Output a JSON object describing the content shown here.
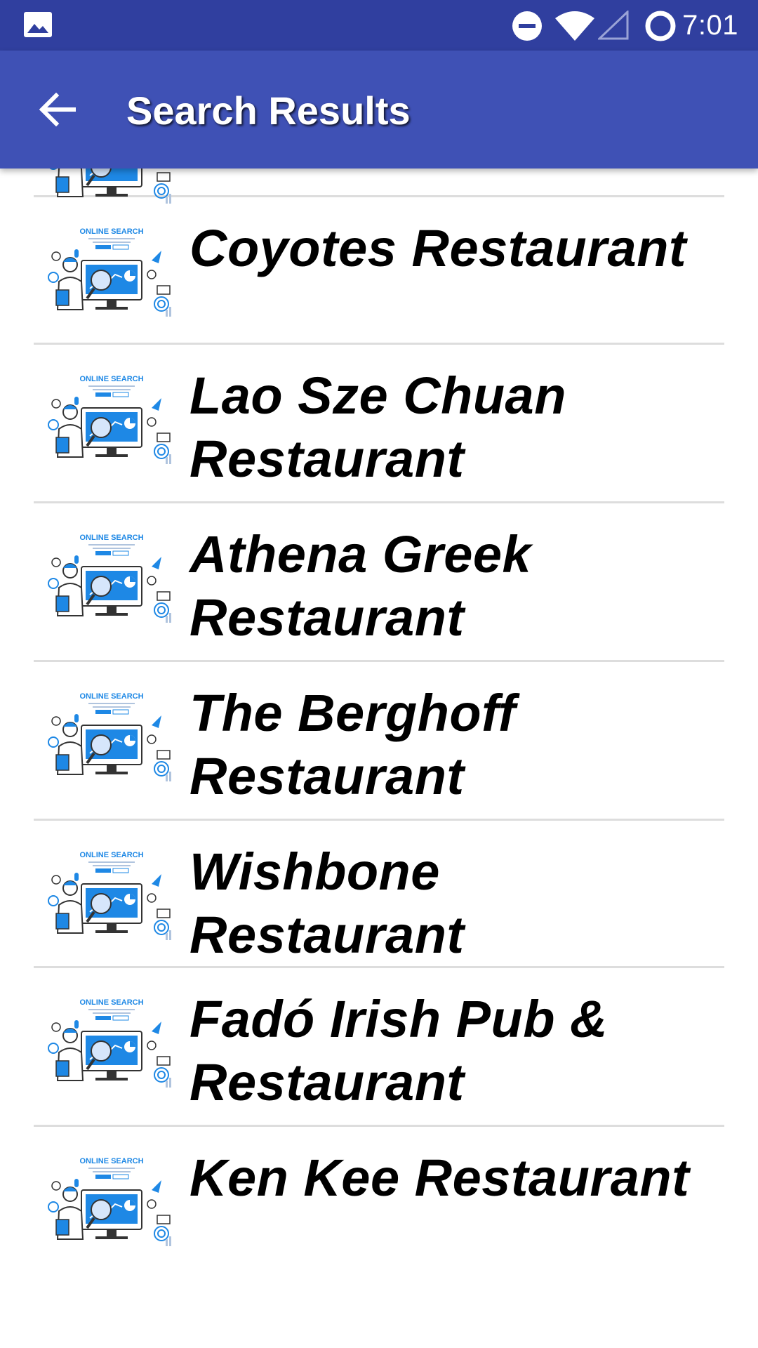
{
  "status_bar": {
    "time": "7:01",
    "icons": [
      "gallery-icon",
      "do-not-disturb-icon",
      "wifi-icon",
      "signal-icon",
      "battery-ring-icon"
    ]
  },
  "app_bar": {
    "back_icon": "arrow-back-icon",
    "title": "Search Results"
  },
  "thumbnail": {
    "caption": "ONLINE SEARCH",
    "accent": "#1E88E5"
  },
  "results": [
    {
      "name": "Coyotes Restaurant"
    },
    {
      "name": "Lao Sze Chuan Restaurant"
    },
    {
      "name": "Athena Greek Restaurant"
    },
    {
      "name": "The Berghoff Restaurant"
    },
    {
      "name": "Wishbone Restaurant"
    },
    {
      "name": "Fadó Irish Pub & Restaurant"
    },
    {
      "name": "Ken Kee Restaurant"
    }
  ],
  "colors": {
    "status_bar": "#303F9F",
    "app_bar": "#3F51B5",
    "divider": "#DDDDDD"
  }
}
